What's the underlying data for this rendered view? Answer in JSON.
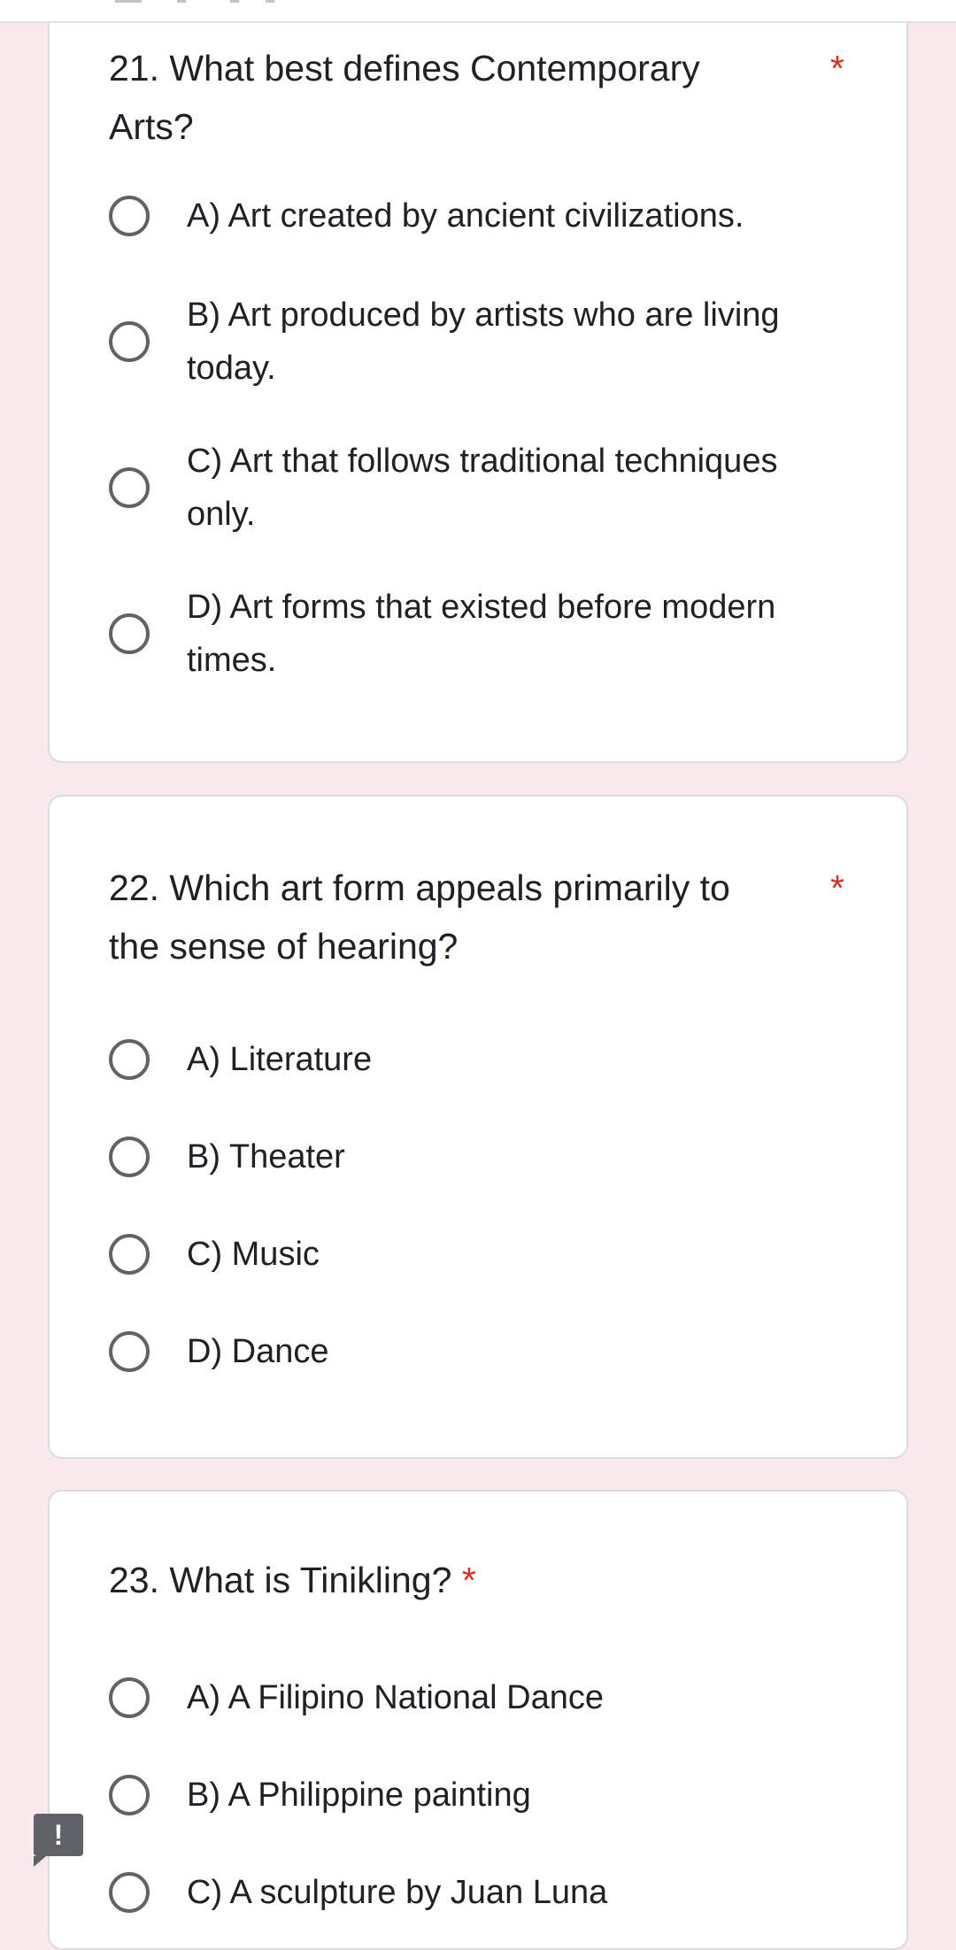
{
  "questions": [
    {
      "title": "21. What best defines Contemporary Arts?",
      "title_line1": "21. What best defines Contemporary",
      "title_line2": "Arts?",
      "required": "*",
      "options": [
        {
          "line1": "A) Art created by ancient civilizations.",
          "line2": ""
        },
        {
          "line1": "B) Art produced by artists who are living",
          "line2": "today."
        },
        {
          "line1": "C) Art that follows traditional techniques",
          "line2": "only."
        },
        {
          "line1": "D) Art forms that existed before modern",
          "line2": "times."
        }
      ]
    },
    {
      "title_line1": "22. Which art form appeals primarily to",
      "title_line2": "the sense of hearing?",
      "required": "*",
      "options": [
        {
          "label": "A) Literature"
        },
        {
          "label": "B) Theater"
        },
        {
          "label": "C) Music"
        },
        {
          "label": "D) Dance"
        }
      ]
    },
    {
      "title": "23. What is Tinikling?",
      "required": "*",
      "options": [
        {
          "label": "A) A Filipino National Dance"
        },
        {
          "label": "B) A Philippine painting"
        },
        {
          "label": "C) A sculpture by Juan Luna"
        }
      ]
    }
  ],
  "feedback_icon": "!",
  "colors": {
    "page_bg": "#f9e9ec",
    "required_star": "#d93025",
    "radio_border": "#5f6368"
  },
  "icons": {
    "feedback": "report-issue-icon"
  }
}
